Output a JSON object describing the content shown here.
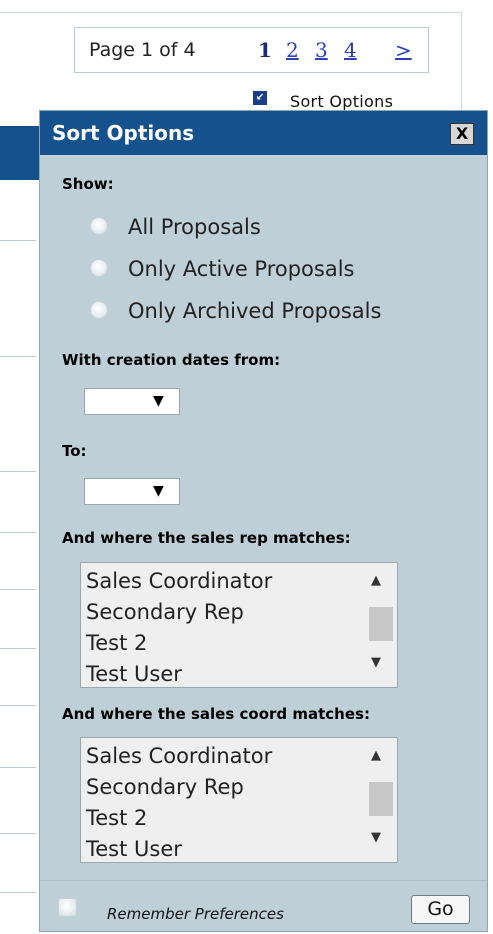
{
  "pager": {
    "label": "Page 1 of 4",
    "current": "1",
    "links": [
      "2",
      "3",
      "4",
      ">"
    ]
  },
  "sort_link": {
    "label": "Sort Options"
  },
  "panel": {
    "title": "Sort Options",
    "close_label": "X",
    "show": {
      "label": "Show:",
      "options": [
        "All Proposals",
        "Only Active Proposals",
        "Only Archived Proposals"
      ]
    },
    "from_label": "With creation dates from:",
    "from_value": "",
    "to_label": "To:",
    "to_value": "",
    "sales_rep": {
      "label": "And where the sales rep matches:",
      "options": [
        "Sales Coordinator",
        "Secondary Rep",
        "Test 2",
        "Test User"
      ]
    },
    "sales_coord": {
      "label": "And where the sales coord matches:",
      "options": [
        "Sales Coordinator",
        "Secondary Rep",
        "Test 2",
        "Test User"
      ]
    },
    "remember_label": "Remember Preferences",
    "go_label": "Go"
  },
  "colors": {
    "header": "#15518c",
    "panel_bg": "#bfcfd8",
    "link": "#2b3fb8"
  }
}
